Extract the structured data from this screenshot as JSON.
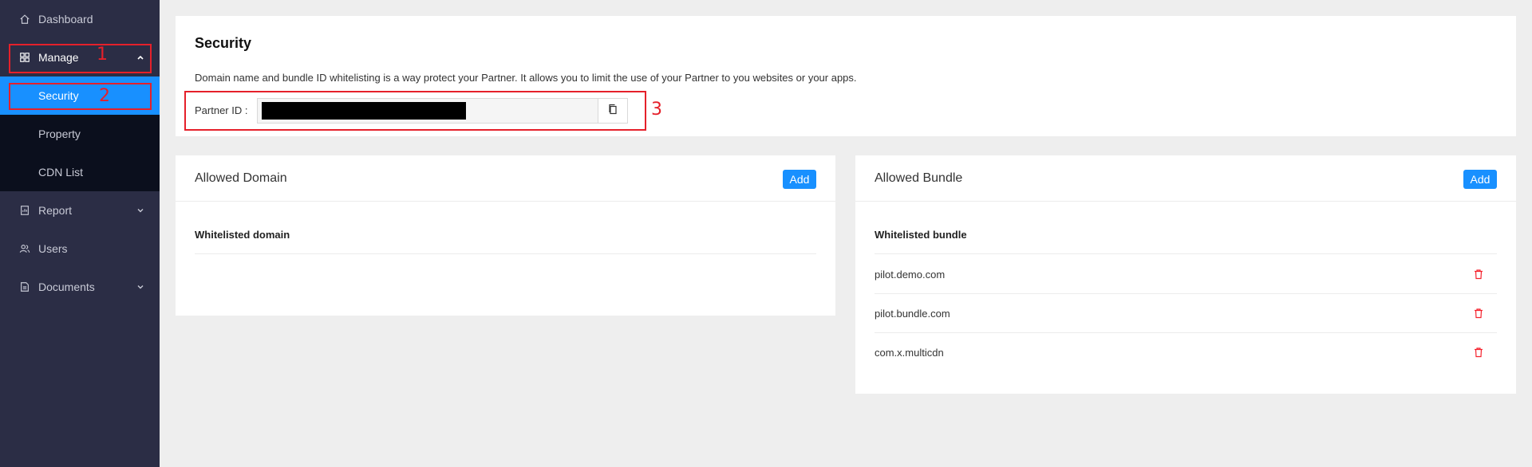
{
  "sidebar": {
    "dashboard": "Dashboard",
    "manage": "Manage",
    "submenu": {
      "security": "Security",
      "property": "Property",
      "cdn_list": "CDN List"
    },
    "report": "Report",
    "users": "Users",
    "documents": "Documents"
  },
  "annotations": {
    "one": "1",
    "two": "2",
    "three": "3"
  },
  "security": {
    "title": "Security",
    "description": "Domain name and bundle ID whitelisting is a way protect your Partner. It allows you to limit the use of your Partner to you websites or your apps.",
    "partner_label": "Partner ID :"
  },
  "domain_panel": {
    "title": "Allowed Domain",
    "add_label": "Add",
    "column_header": "Whitelisted domain"
  },
  "bundle_panel": {
    "title": "Allowed Bundle",
    "add_label": "Add",
    "column_header": "Whitelisted bundle",
    "items": [
      "pilot.demo.com",
      "pilot.bundle.com",
      "com.x.multicdn"
    ]
  },
  "colors": {
    "sidebar": "#2b2d45",
    "submenu": "#0b0f1d",
    "accent": "#1890ff",
    "annotation": "#e5202a",
    "delete": "#f5222d"
  }
}
